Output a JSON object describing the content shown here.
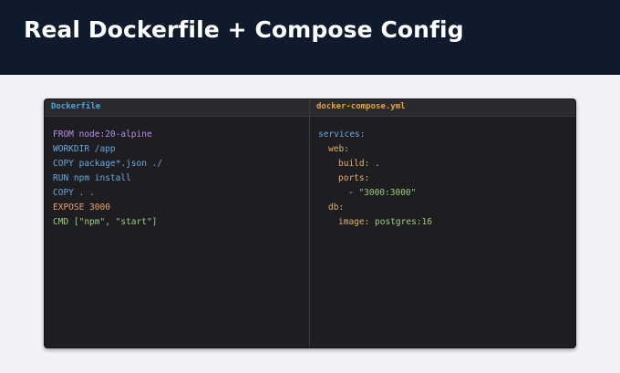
{
  "header": {
    "title": "Real Dockerfile + Compose Config"
  },
  "colors": {
    "header_bg": "#0f1b2d",
    "page_bg": "#f1f2f6",
    "editor_bg": "#1e1e22",
    "dockerfile_tab": "#4fa3e0",
    "compose_tab": "#e8a33c",
    "purple": "#b98ee8",
    "blue": "#6aa8dc",
    "orange": "#e8a06a",
    "green": "#9ccc7c",
    "gold": "#e0b46a",
    "gray": "#c8c8c8"
  },
  "dockerfile": {
    "tab_label": "Dockerfile",
    "lines": [
      {
        "text": "FROM node:20-alpine",
        "tone": "purple"
      },
      {
        "text": "WORKDIR /app",
        "tone": "blue"
      },
      {
        "text": "COPY package*.json ./",
        "tone": "blue"
      },
      {
        "text": "RUN npm install",
        "tone": "blue"
      },
      {
        "text": "COPY . .",
        "tone": "blue"
      },
      {
        "text": "EXPOSE 3000",
        "tone": "orange"
      },
      {
        "text": "CMD [\"npm\", \"start\"]",
        "tone": "green"
      }
    ]
  },
  "compose": {
    "tab_label": "docker-compose.yml",
    "lines": [
      {
        "indent": 0,
        "key": "services:",
        "value": "",
        "key_tone": "blue",
        "value_tone": "green"
      },
      {
        "indent": 1,
        "key": "web:",
        "value": "",
        "key_tone": "gold",
        "value_tone": "green"
      },
      {
        "indent": 2,
        "key": "build:",
        "value": " .",
        "key_tone": "gold",
        "value_tone": "gray"
      },
      {
        "indent": 2,
        "key": "ports:",
        "value": "",
        "key_tone": "gold",
        "value_tone": "green"
      },
      {
        "indent": 3,
        "key": "- ",
        "value": "\"3000:3000\"",
        "key_tone": "gray",
        "value_tone": "green"
      },
      {
        "indent": 1,
        "key": "db:",
        "value": "",
        "key_tone": "gold",
        "value_tone": "green"
      },
      {
        "indent": 2,
        "key": "image:",
        "value": " postgres:16",
        "key_tone": "gold",
        "value_tone": "green"
      }
    ]
  }
}
